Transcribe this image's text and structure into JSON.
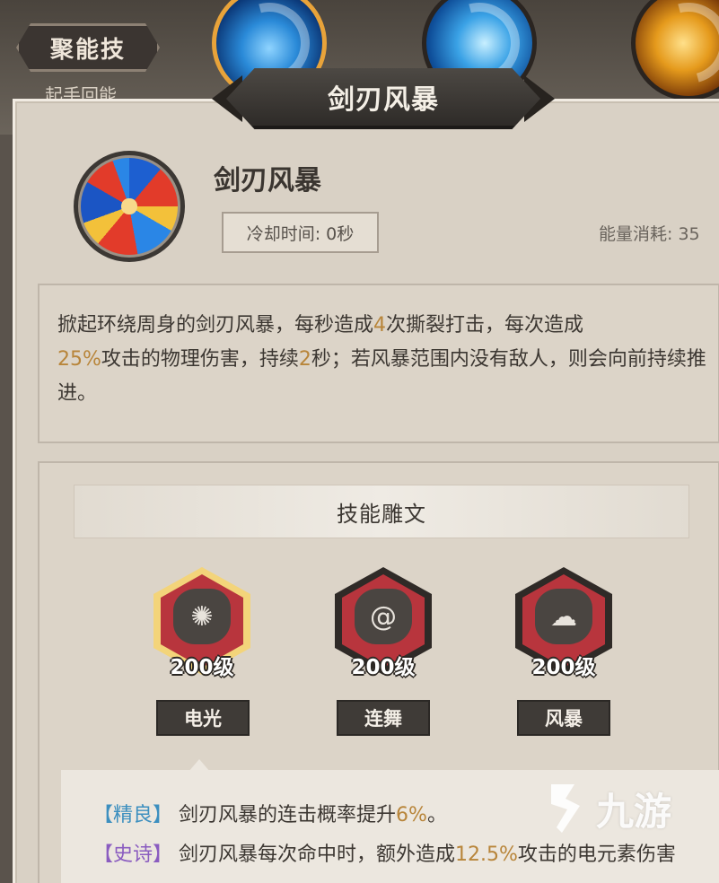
{
  "top_tab": {
    "label": "聚能技",
    "sub_label": "起手回能"
  },
  "top_skills": [
    {
      "icon": "water-vortex-skill-icon"
    },
    {
      "icon": "ice-splash-skill-icon"
    },
    {
      "icon": "golden-lightning-skill-icon"
    }
  ],
  "banner_title": "剑刃风暴",
  "skill": {
    "icon": "blade-storm-icon",
    "name": "剑刃风暴",
    "cooldown": "冷却时间: 0秒",
    "energy": "能量消耗: 35"
  },
  "description": {
    "p1": "掀起环绕周身的剑刃风暴，每秒造成",
    "n1": "4",
    "p2": "次撕裂打击，每次造成",
    "n2": "25%",
    "p3": "攻击的物理伤害，持续",
    "n3": "2",
    "p4": "秒；若风暴范围内没有敌人，则会向前持续推进。"
  },
  "runes": {
    "header": "技能雕文",
    "items": [
      {
        "level": "200级",
        "label": "电光",
        "icon": "crack-icon",
        "selected": true
      },
      {
        "level": "200级",
        "label": "连舞",
        "icon": "whirl-icon",
        "selected": false
      },
      {
        "level": "200级",
        "label": "风暴",
        "icon": "tornado-icon",
        "selected": false
      }
    ]
  },
  "details": [
    {
      "tag": "【精良】",
      "text": "剑刃风暴的连击概率提升",
      "value": "6%",
      "tail": "。"
    },
    {
      "tag": "【史诗】",
      "text": "剑刃风暴每次命中时，额外造成",
      "value": "12.5%",
      "tail": "攻击的电元素伤害"
    }
  ],
  "watermark": {
    "text": "九游"
  },
  "colors": {
    "highlight": "#b8853a",
    "rune_red": "#b8353d",
    "fine_tag": "#3c8fbf",
    "epic_tag": "#8a5cc0"
  }
}
